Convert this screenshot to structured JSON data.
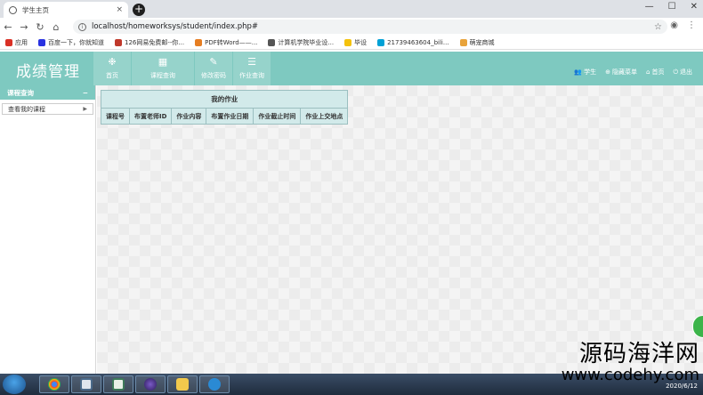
{
  "browser": {
    "tab_title": "学生主页",
    "tab_close": "×",
    "new_tab": "+",
    "window_buttons": [
      "—",
      "☐",
      "✕"
    ],
    "url": "localhost/homeworksys/student/index.php#",
    "nav": {
      "back": "←",
      "forward": "→",
      "reload": "↻",
      "home": "⌂"
    }
  },
  "bookmarks": [
    {
      "label": "应用",
      "color": "#d93025"
    },
    {
      "label": "百度一下，你就知道",
      "color": "#2932e1"
    },
    {
      "label": "126网易免费邮--你...",
      "color": "#c0392b"
    },
    {
      "label": "PDF转Word——...",
      "color": "#e67e22"
    },
    {
      "label": "计算机学院毕业设...",
      "color": "#555555"
    },
    {
      "label": "毕设",
      "color": "#f4c20d"
    },
    {
      "label": "21739463604_bili...",
      "color": "#00a1d6"
    },
    {
      "label": "萌宠商城",
      "color": "#e8a33a"
    }
  ],
  "app": {
    "brand": "成绩管理",
    "topnav": [
      {
        "label": "首页",
        "icon": "❉"
      },
      {
        "label": "课程查询",
        "icon": "▦"
      },
      {
        "label": "修改密码",
        "icon": "✎"
      },
      {
        "label": "作业查询",
        "icon": "☰"
      }
    ],
    "userbar": [
      {
        "label": "学生",
        "icon": "👥"
      },
      {
        "label": "隐藏菜单",
        "icon": "⊕"
      },
      {
        "label": "首页",
        "icon": "⌂"
      },
      {
        "label": "退出",
        "icon": "⏻"
      }
    ],
    "accent": "#7ec9c0"
  },
  "sidebar": {
    "title": "课程查询",
    "toggle": "−",
    "items": [
      {
        "label": "查看我的课程",
        "arrow": "▶"
      }
    ]
  },
  "homework_table": {
    "caption": "我的作业",
    "columns": [
      "课程号",
      "布置老师ID",
      "作业内容",
      "布置作业日期",
      "作业截止时间",
      "作业上交地点"
    ]
  },
  "taskbar": {
    "date": "2020/6/12"
  },
  "watermark": {
    "cn": "源码海洋网",
    "url": "www.codehy.com"
  }
}
